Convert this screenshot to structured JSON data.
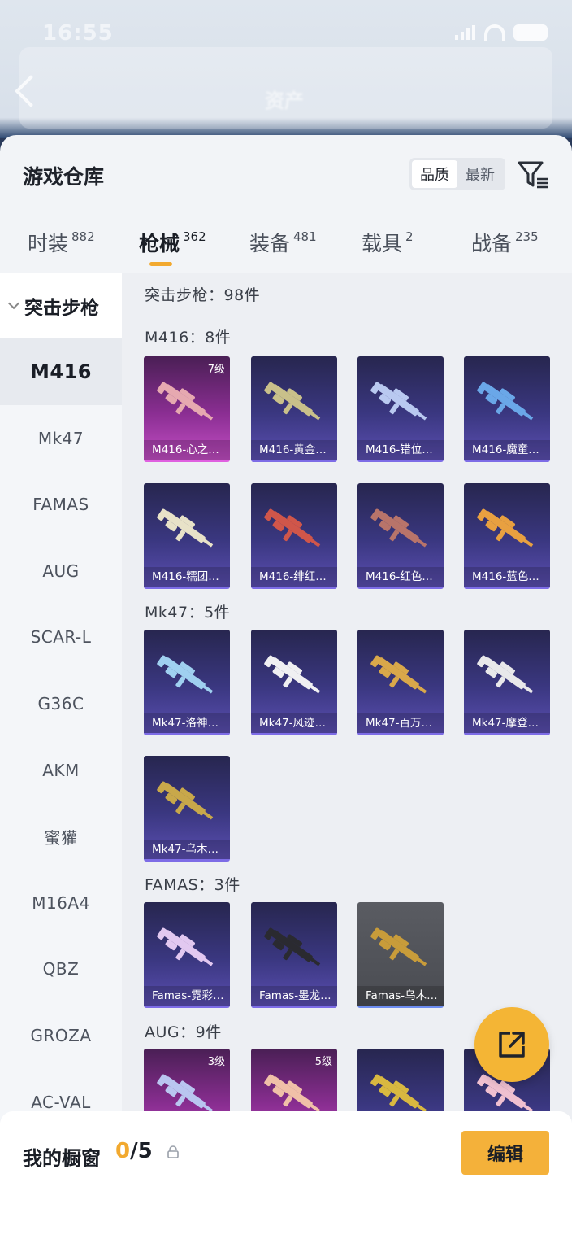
{
  "status_bar": {
    "time": "16:55"
  },
  "backdrop": {
    "title": "资产"
  },
  "header": {
    "title": "游戏仓库",
    "sort_options": [
      "品质",
      "最新"
    ],
    "active_sort": "品质"
  },
  "tabs": [
    {
      "label": "时装",
      "count": "882"
    },
    {
      "label": "枪械",
      "count": "362",
      "active": true
    },
    {
      "label": "装备",
      "count": "481"
    },
    {
      "label": "载具",
      "count": "2"
    },
    {
      "label": "战备",
      "count": "235"
    }
  ],
  "sidebar": {
    "category": "突击步枪",
    "items": [
      "M416",
      "Mk47",
      "FAMAS",
      "AUG",
      "SCAR-L",
      "G36C",
      "AKM",
      "蜜獾",
      "M16A4",
      "QBZ",
      "GROZA",
      "AC-VAL"
    ],
    "active": "M416"
  },
  "content": {
    "category_summary": "突击步枪：98件",
    "sections": [
      {
        "title": "M416：8件",
        "items": [
          {
            "label": "M416-心之…",
            "level": "7级",
            "rarity": "pink",
            "color": "#e6a9b0"
          },
          {
            "label": "M416-黄金…",
            "rarity": "purple",
            "color": "#c9c08a"
          },
          {
            "label": "M416-错位…",
            "rarity": "purple",
            "color": "#b9c9f0"
          },
          {
            "label": "M416-魔童…",
            "rarity": "purple",
            "color": "#6aa7e8"
          },
          {
            "label": "M416-糯团…",
            "rarity": "purple",
            "color": "#e8e2c8"
          },
          {
            "label": "M416-绯红…",
            "rarity": "purple",
            "color": "#d0564a"
          },
          {
            "label": "M416-红色…",
            "rarity": "purple",
            "color": "#b8746a"
          },
          {
            "label": "M416-蓝色…",
            "rarity": "purple",
            "color": "#e8a040"
          }
        ]
      },
      {
        "title": "Mk47：5件",
        "items": [
          {
            "label": "Mk47-洛神…",
            "rarity": "purple",
            "color": "#9fd0f0"
          },
          {
            "label": "Mk47-风迹…",
            "rarity": "purple",
            "color": "#f0f0f2"
          },
          {
            "label": "Mk47-百万…",
            "rarity": "purple",
            "color": "#d9a84a"
          },
          {
            "label": "Mk47-摩登…",
            "rarity": "purple",
            "color": "#e8e8ea"
          },
          {
            "label": "Mk47-乌木…",
            "rarity": "purple",
            "color": "#c8a84a"
          }
        ]
      },
      {
        "title": "FAMAS：3件",
        "items": [
          {
            "label": "Famas-霓彩…",
            "rarity": "purple",
            "color": "#e2c8f0"
          },
          {
            "label": "Famas-墨龙…",
            "rarity": "purple",
            "color": "#2a2a30"
          },
          {
            "label": "Famas-乌木…",
            "rarity": "grey",
            "color": "#c89c3a"
          }
        ]
      },
      {
        "title": "AUG：9件",
        "items": [
          {
            "label": "",
            "level": "3级",
            "rarity": "pink",
            "color": "#b9c6f0"
          },
          {
            "label": "",
            "level": "5级",
            "rarity": "pink",
            "color": "#f0c0a8"
          },
          {
            "label": "",
            "rarity": "purple",
            "color": "#d8b840"
          },
          {
            "label": "",
            "rarity": "purple",
            "color": "#f0c0d0"
          }
        ]
      }
    ]
  },
  "bottom_bar": {
    "showcase_label": "我的橱窗",
    "showcase_current": "0",
    "showcase_max": "/5",
    "edit_label": "编辑"
  },
  "colors": {
    "accent": "#f2a92f",
    "card_purple": "#3a3780",
    "card_pink": "#8a2e92"
  }
}
